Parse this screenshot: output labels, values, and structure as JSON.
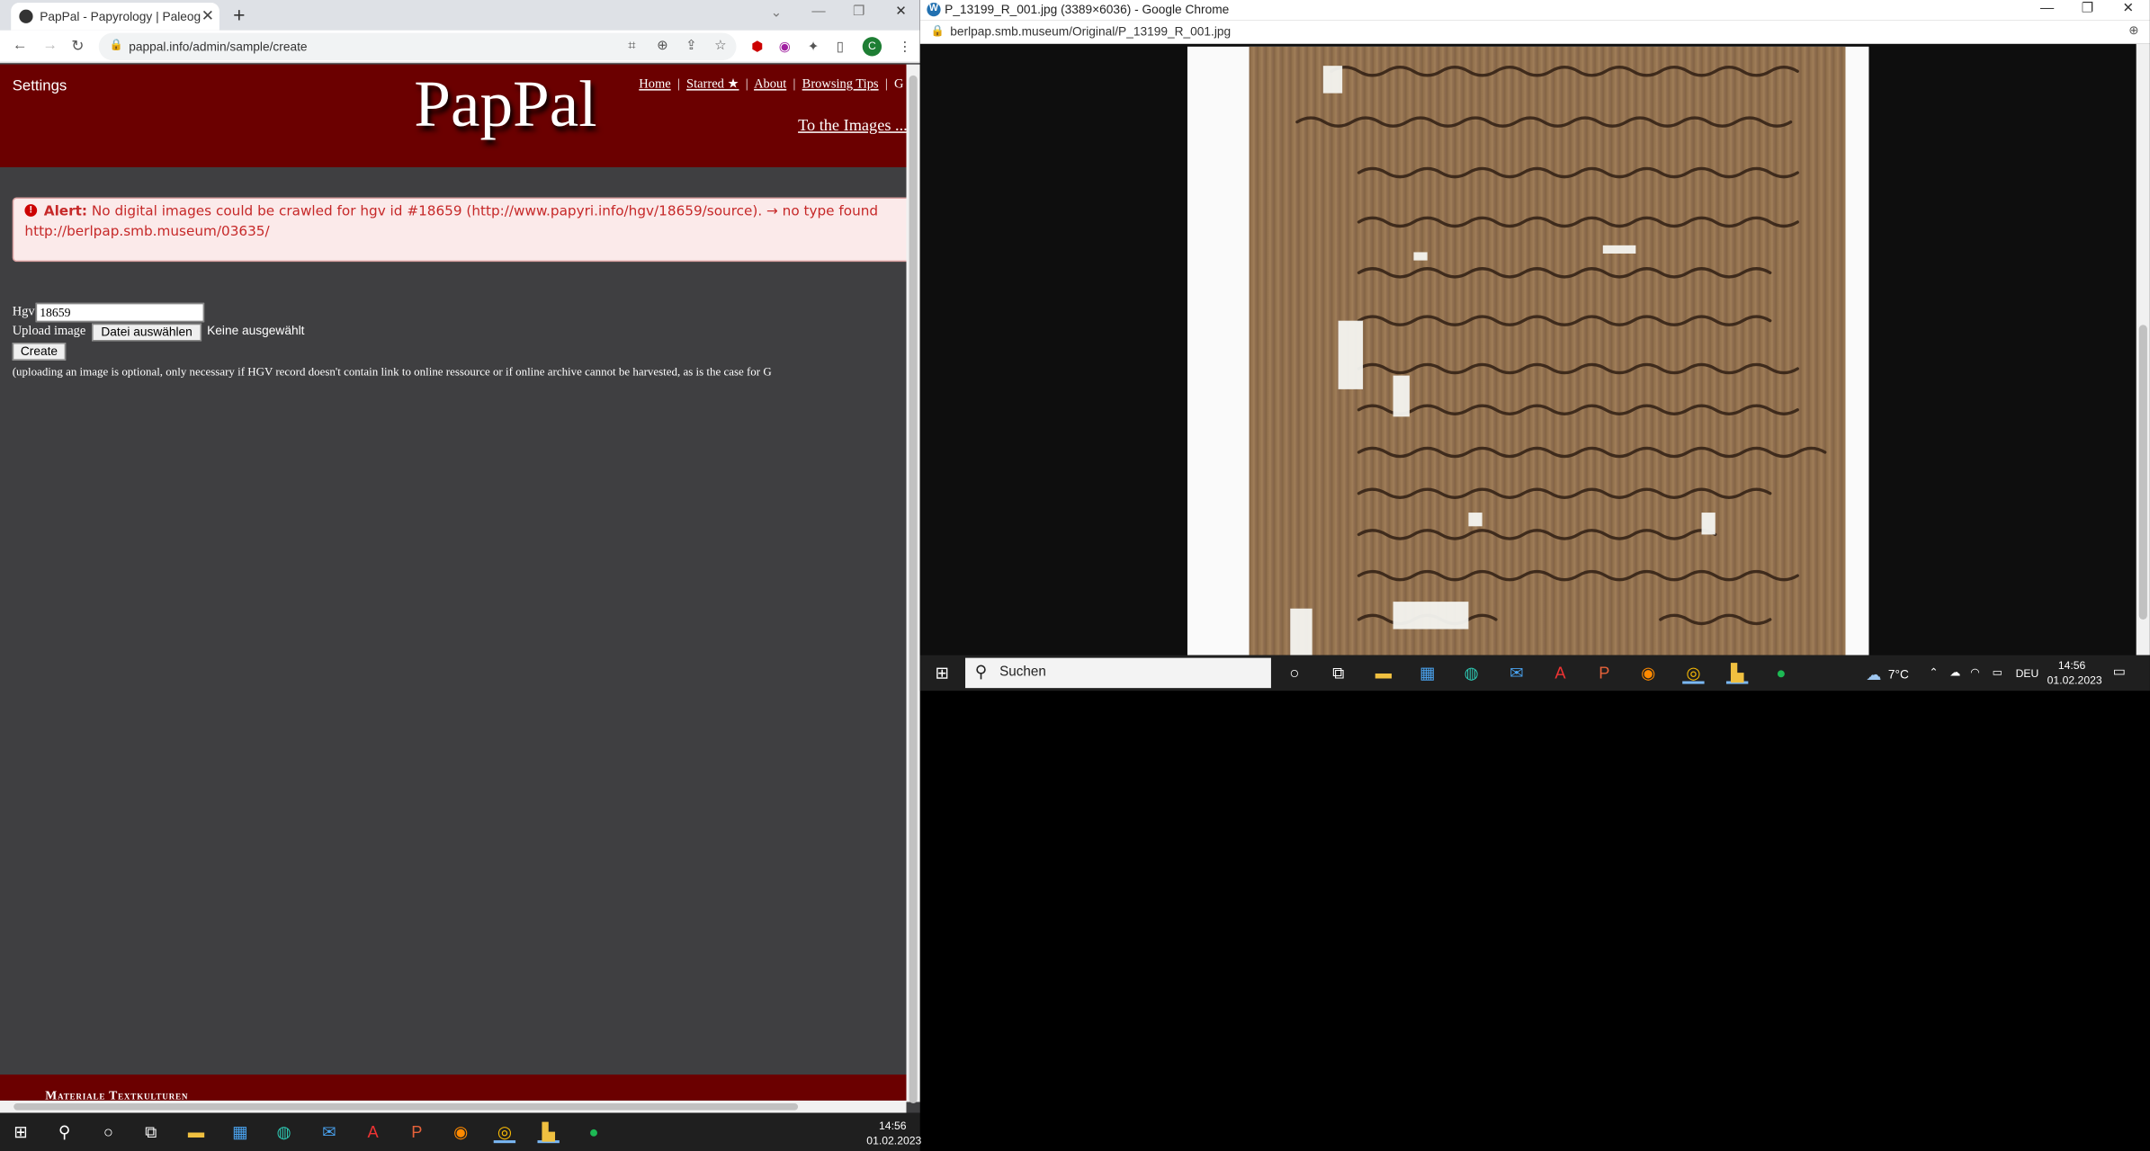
{
  "left_window": {
    "tab_title": "PapPal - Papyrology | Paleograph",
    "url": "pappal.info/admin/sample/create",
    "avatar_letter": "C",
    "header": {
      "settings": "Settings",
      "logo": "PapPal",
      "nav": [
        "Home",
        "Starred ★",
        "About",
        "Browsing Tips"
      ],
      "to_images": "To the Images ..."
    },
    "alert": {
      "label": "Alert:",
      "line1": "No digital images could be crawled for hgv id #18659 (http://www.papyri.info/hgv/18659/source). → no type found",
      "line2": "http://berlpap.smb.museum/03635/"
    },
    "form": {
      "hgv_label": "Hgv",
      "hgv_value": "18659",
      "upload_label": "Upload image",
      "file_button": "Datei auswählen",
      "no_file": "Keine ausgewählt",
      "create_button": "Create",
      "note": "(uploading an image is optional, only necessary if HGV record doesn't contain link to online ressource or if online archive cannot be harvested, as is the case for G"
    },
    "footer": "Materiale Textkulturen",
    "taskbar": {
      "time": "14:56",
      "date": "01.02.2023"
    }
  },
  "right_window": {
    "title": "P_13199_R_001.jpg (3389×6036) - Google Chrome",
    "url": "berlpap.smb.museum/Original/P_13199_R_001.jpg",
    "taskbar": {
      "search": "Suchen",
      "weather": "7°C",
      "lang": "DEU",
      "time": "14:56",
      "date": "01.02.2023"
    }
  },
  "colors": {
    "header": "#6b0000",
    "page_bg": "#3f3f41",
    "alert_text": "#c62828",
    "taskbar": "#1f1f1f"
  }
}
